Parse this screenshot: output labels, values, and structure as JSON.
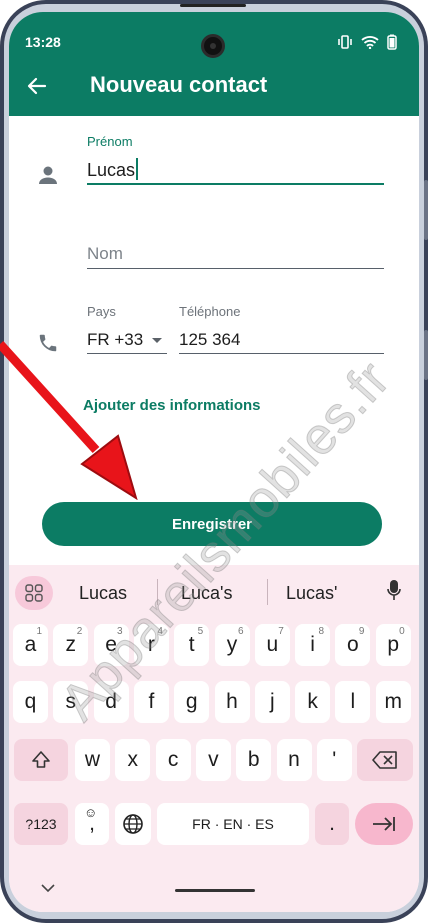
{
  "status_bar": {
    "time": "13:28"
  },
  "app_bar": {
    "title": "Nouveau contact"
  },
  "form": {
    "first_name": {
      "label": "Prénom",
      "value": "Lucas"
    },
    "last_name": {
      "placeholder": "Nom"
    },
    "country": {
      "label": "Pays",
      "value": "FR +33"
    },
    "phone": {
      "label": "Téléphone",
      "value": "125 364"
    },
    "add_info_label": "Ajouter des informations",
    "save_label": "Enregistrer"
  },
  "keyboard": {
    "suggestions": [
      "Lucas",
      "Luca's",
      "Lucas'"
    ],
    "row1": [
      "a",
      "z",
      "e",
      "r",
      "t",
      "y",
      "u",
      "i",
      "o",
      "p"
    ],
    "row1_hints": [
      "1",
      "2",
      "3",
      "4",
      "5",
      "6",
      "7",
      "8",
      "9",
      "0"
    ],
    "row2": [
      "q",
      "s",
      "d",
      "f",
      "g",
      "h",
      "j",
      "k",
      "l",
      "m"
    ],
    "row3": [
      "w",
      "x",
      "c",
      "v",
      "b",
      "n",
      "'"
    ],
    "symbols_label": "?123",
    "comma_label": ",",
    "space_label": "FR · EN · ES",
    "period_label": "."
  },
  "watermark": "Appareilsmobiles.fr",
  "colors": {
    "primary": "#0c7c64",
    "keyboard_bg": "#fbeaf0",
    "arrow": "#e8141a"
  }
}
